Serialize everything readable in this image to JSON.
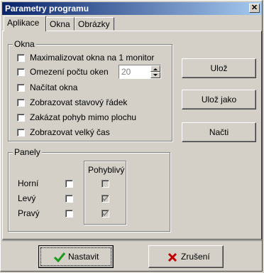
{
  "window": {
    "title": "Parametry programu",
    "close_glyph": "✕"
  },
  "tabs": [
    {
      "label": "Aplikace",
      "active": true
    },
    {
      "label": "Okna",
      "active": false
    },
    {
      "label": "Obrázky",
      "active": false
    }
  ],
  "okna_group": {
    "legend": "Okna",
    "options": [
      {
        "label": "Maximalizovat okna na 1 monitor",
        "checked": false
      },
      {
        "label": "Omezení počtu oken",
        "checked": false
      },
      {
        "label": "Načítat okna",
        "checked": false
      },
      {
        "label": "Zobrazovat stavový řádek",
        "checked": false
      },
      {
        "label": "Zakázat pohyb mimo plochu",
        "checked": false
      },
      {
        "label": "Zobrazovat velký čas",
        "checked": false
      }
    ],
    "window_limit_value": "20"
  },
  "panely_group": {
    "legend": "Panely",
    "movable_legend": "Pohyblivý",
    "rows": [
      {
        "label": "Horní",
        "checked": false,
        "movable_checked": false
      },
      {
        "label": "Levý",
        "checked": false,
        "movable_checked": true
      },
      {
        "label": "Pravý",
        "checked": false,
        "movable_checked": true
      }
    ]
  },
  "side_buttons": {
    "save": "Ulož",
    "save_as": "Ulož jako",
    "load": "Načti"
  },
  "footer": {
    "ok": "Nastavit",
    "cancel": "Zrušení"
  },
  "colors": {
    "title_start": "#0a246a",
    "title_end": "#a6caf0",
    "ok_check": "#1a9a1a",
    "cancel_x": "#c00000"
  }
}
